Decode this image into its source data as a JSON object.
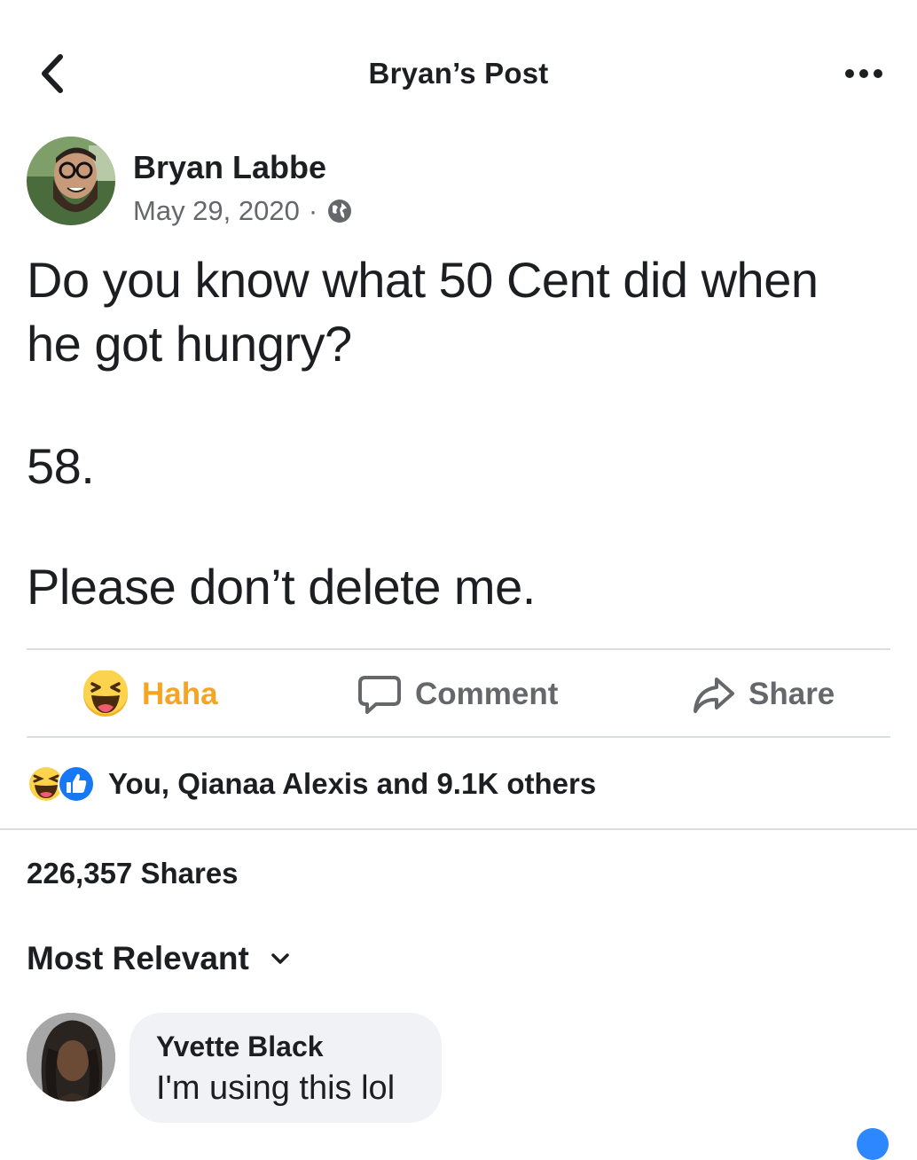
{
  "header": {
    "title": "Bryan’s Post",
    "back_icon": "chevron-left-icon",
    "more_icon": "more-horizontal-icon"
  },
  "post": {
    "author": "Bryan Labbe",
    "date": "May 29, 2020",
    "separator": "·",
    "privacy_icon": "globe-icon",
    "lines": [
      "Do you know what 50 Cent did when",
      "he got hungry?",
      "58.",
      "Please don’t delete me."
    ]
  },
  "actions": {
    "reaction_label": "Haha",
    "comment_label": "Comment",
    "share_label": "Share"
  },
  "reactions": {
    "summary": "You, Qianaa Alexis and 9.1K others",
    "icons": [
      "haha-emoji-icon",
      "like-thumb-icon"
    ]
  },
  "shares": {
    "count_label": "226,357 Shares"
  },
  "comments": {
    "sort_label": "Most Relevant",
    "items": [
      {
        "author": "Yvette Black",
        "text": "I'm using this lol"
      }
    ]
  },
  "colors": {
    "haha_accent": "#f5a524",
    "like_blue": "#1877f2",
    "muted_text": "#65676b",
    "bubble_bg": "#f0f2f5"
  }
}
